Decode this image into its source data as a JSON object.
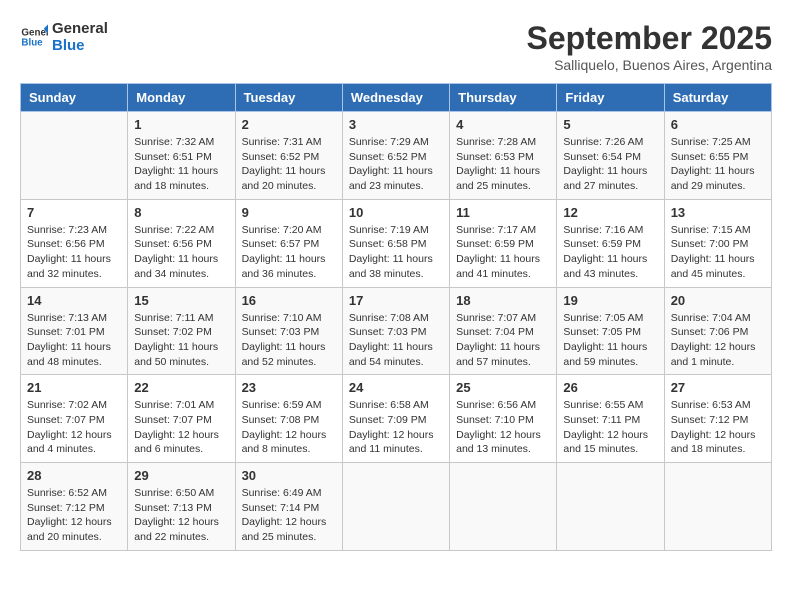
{
  "header": {
    "logo_line1": "General",
    "logo_line2": "Blue",
    "month": "September 2025",
    "location": "Salliquelo, Buenos Aires, Argentina"
  },
  "weekdays": [
    "Sunday",
    "Monday",
    "Tuesday",
    "Wednesday",
    "Thursday",
    "Friday",
    "Saturday"
  ],
  "weeks": [
    [
      {
        "day": "",
        "info": ""
      },
      {
        "day": "1",
        "info": "Sunrise: 7:32 AM\nSunset: 6:51 PM\nDaylight: 11 hours\nand 18 minutes."
      },
      {
        "day": "2",
        "info": "Sunrise: 7:31 AM\nSunset: 6:52 PM\nDaylight: 11 hours\nand 20 minutes."
      },
      {
        "day": "3",
        "info": "Sunrise: 7:29 AM\nSunset: 6:52 PM\nDaylight: 11 hours\nand 23 minutes."
      },
      {
        "day": "4",
        "info": "Sunrise: 7:28 AM\nSunset: 6:53 PM\nDaylight: 11 hours\nand 25 minutes."
      },
      {
        "day": "5",
        "info": "Sunrise: 7:26 AM\nSunset: 6:54 PM\nDaylight: 11 hours\nand 27 minutes."
      },
      {
        "day": "6",
        "info": "Sunrise: 7:25 AM\nSunset: 6:55 PM\nDaylight: 11 hours\nand 29 minutes."
      }
    ],
    [
      {
        "day": "7",
        "info": "Sunrise: 7:23 AM\nSunset: 6:56 PM\nDaylight: 11 hours\nand 32 minutes."
      },
      {
        "day": "8",
        "info": "Sunrise: 7:22 AM\nSunset: 6:56 PM\nDaylight: 11 hours\nand 34 minutes."
      },
      {
        "day": "9",
        "info": "Sunrise: 7:20 AM\nSunset: 6:57 PM\nDaylight: 11 hours\nand 36 minutes."
      },
      {
        "day": "10",
        "info": "Sunrise: 7:19 AM\nSunset: 6:58 PM\nDaylight: 11 hours\nand 38 minutes."
      },
      {
        "day": "11",
        "info": "Sunrise: 7:17 AM\nSunset: 6:59 PM\nDaylight: 11 hours\nand 41 minutes."
      },
      {
        "day": "12",
        "info": "Sunrise: 7:16 AM\nSunset: 6:59 PM\nDaylight: 11 hours\nand 43 minutes."
      },
      {
        "day": "13",
        "info": "Sunrise: 7:15 AM\nSunset: 7:00 PM\nDaylight: 11 hours\nand 45 minutes."
      }
    ],
    [
      {
        "day": "14",
        "info": "Sunrise: 7:13 AM\nSunset: 7:01 PM\nDaylight: 11 hours\nand 48 minutes."
      },
      {
        "day": "15",
        "info": "Sunrise: 7:11 AM\nSunset: 7:02 PM\nDaylight: 11 hours\nand 50 minutes."
      },
      {
        "day": "16",
        "info": "Sunrise: 7:10 AM\nSunset: 7:03 PM\nDaylight: 11 hours\nand 52 minutes."
      },
      {
        "day": "17",
        "info": "Sunrise: 7:08 AM\nSunset: 7:03 PM\nDaylight: 11 hours\nand 54 minutes."
      },
      {
        "day": "18",
        "info": "Sunrise: 7:07 AM\nSunset: 7:04 PM\nDaylight: 11 hours\nand 57 minutes."
      },
      {
        "day": "19",
        "info": "Sunrise: 7:05 AM\nSunset: 7:05 PM\nDaylight: 11 hours\nand 59 minutes."
      },
      {
        "day": "20",
        "info": "Sunrise: 7:04 AM\nSunset: 7:06 PM\nDaylight: 12 hours\nand 1 minute."
      }
    ],
    [
      {
        "day": "21",
        "info": "Sunrise: 7:02 AM\nSunset: 7:07 PM\nDaylight: 12 hours\nand 4 minutes."
      },
      {
        "day": "22",
        "info": "Sunrise: 7:01 AM\nSunset: 7:07 PM\nDaylight: 12 hours\nand 6 minutes."
      },
      {
        "day": "23",
        "info": "Sunrise: 6:59 AM\nSunset: 7:08 PM\nDaylight: 12 hours\nand 8 minutes."
      },
      {
        "day": "24",
        "info": "Sunrise: 6:58 AM\nSunset: 7:09 PM\nDaylight: 12 hours\nand 11 minutes."
      },
      {
        "day": "25",
        "info": "Sunrise: 6:56 AM\nSunset: 7:10 PM\nDaylight: 12 hours\nand 13 minutes."
      },
      {
        "day": "26",
        "info": "Sunrise: 6:55 AM\nSunset: 7:11 PM\nDaylight: 12 hours\nand 15 minutes."
      },
      {
        "day": "27",
        "info": "Sunrise: 6:53 AM\nSunset: 7:12 PM\nDaylight: 12 hours\nand 18 minutes."
      }
    ],
    [
      {
        "day": "28",
        "info": "Sunrise: 6:52 AM\nSunset: 7:12 PM\nDaylight: 12 hours\nand 20 minutes."
      },
      {
        "day": "29",
        "info": "Sunrise: 6:50 AM\nSunset: 7:13 PM\nDaylight: 12 hours\nand 22 minutes."
      },
      {
        "day": "30",
        "info": "Sunrise: 6:49 AM\nSunset: 7:14 PM\nDaylight: 12 hours\nand 25 minutes."
      },
      {
        "day": "",
        "info": ""
      },
      {
        "day": "",
        "info": ""
      },
      {
        "day": "",
        "info": ""
      },
      {
        "day": "",
        "info": ""
      }
    ]
  ]
}
